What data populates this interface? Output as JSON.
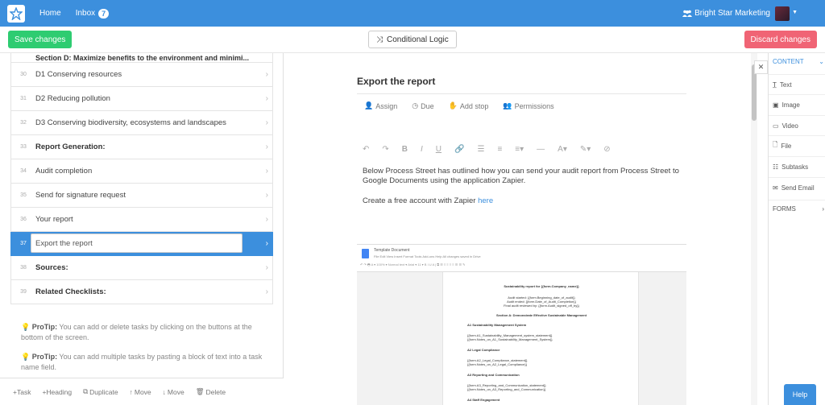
{
  "nav": {
    "home": "Home",
    "inbox": "Inbox",
    "inbox_count": "7",
    "org_name": "Bright Star Marketing"
  },
  "actions": {
    "save": "Save changes",
    "conditional_logic": "Conditional Logic",
    "discard": "Discard changes"
  },
  "tasks": [
    {
      "num": "30",
      "name": "D1 Conserving resources",
      "heading": false
    },
    {
      "num": "31",
      "name": "D2 Reducing pollution",
      "heading": false
    },
    {
      "num": "32",
      "name": "D3 Conserving biodiversity, ecosystems and landscapes",
      "heading": false
    },
    {
      "num": "33",
      "name": "Report Generation:",
      "heading": true
    },
    {
      "num": "34",
      "name": "Audit completion",
      "heading": false
    },
    {
      "num": "35",
      "name": "Send for signature request",
      "heading": false
    },
    {
      "num": "36",
      "name": "Your report",
      "heading": false
    },
    {
      "num": "37",
      "name": "Export the report",
      "heading": false,
      "active": true
    },
    {
      "num": "38",
      "name": "Sources:",
      "heading": true
    },
    {
      "num": "39",
      "name": "Related Checklists:",
      "heading": true
    }
  ],
  "partial_task": "Section D: Maximize benefits to the environment and minimi...",
  "protips": [
    {
      "label": "ProTip:",
      "text": "You can add or delete tasks by clicking on the buttons at the bottom of the screen."
    },
    {
      "label": "ProTip:",
      "text": "You can add multiple tasks by pasting a block of text into a task name field."
    }
  ],
  "bottom_actions": [
    "+Task",
    "+Heading",
    "Duplicate",
    "Move",
    "Move",
    "Delete"
  ],
  "editor": {
    "title": "Export the report",
    "meta": [
      "Assign",
      "Due",
      "Add stop",
      "Permissions"
    ],
    "body_text": "Below Process Street has outlined how you can send your audit report from Process Street to Google Documents using the application Zapier.",
    "line2_prefix": "Create a free account with Zapier ",
    "line2_link": "here"
  },
  "doc": {
    "name": "Template Document",
    "menu": "File  Edit  View  Insert  Format  Tools  Add-ons  Help  All changes saved in Drive",
    "lines": [
      "Sustainability report for {{form.Company_name}}",
      "Audit started: {{form.Beginning_date_of_audit}}",
      "Audit ended: {{form.Date_of_Audit_Completion}}",
      "Final audit reviewed by: {{form.Audit_signed_off_by}}",
      "Section A: Demonstrate Effective Sustainable Management",
      "A1 Sustainability Management System",
      "{{form.A1_Sustainability_Management_system_statement}}",
      "{{form.Notes_on_A1_Sustainability_Management_System}}",
      "A2 Legal Compliance",
      "{{form.A2_Legal_Compliance_statement}}",
      "{{form.Notes_on_A2_Legal_Compliance}}",
      "A3 Reporting and Communication",
      "{{form.A3_Reporting_and_Communication_statement}}",
      "{{form.Notes_on_A3_Reporting_and_Communication}}",
      "A4 Staff Engagement"
    ]
  },
  "widgets": {
    "content_header": "CONTENT",
    "items": [
      "Text",
      "Image",
      "Video",
      "File",
      "Subtasks",
      "Send Email"
    ],
    "forms_header": "FORMS"
  },
  "help": "Help"
}
